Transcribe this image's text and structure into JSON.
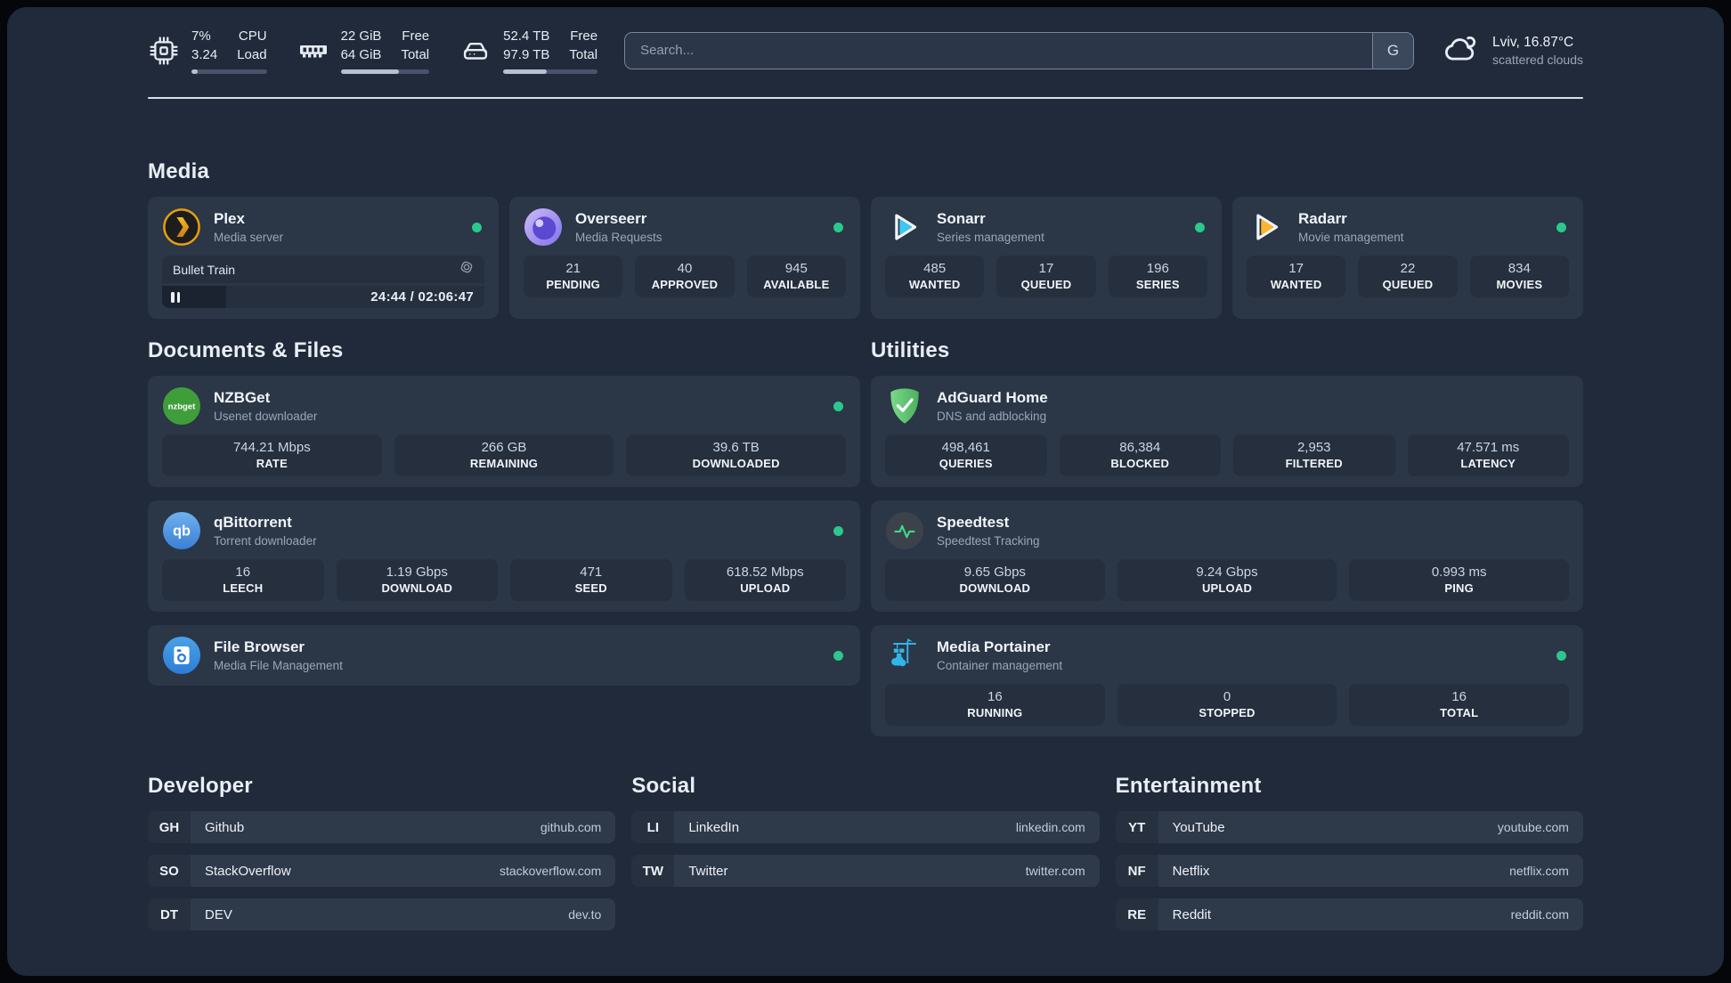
{
  "system_stats": {
    "cpu": {
      "value_line1": "7%",
      "value_line2": "3.24",
      "label_line1": "CPU",
      "label_line2": "Load",
      "progress_pct": 8
    },
    "memory": {
      "value_line1": "22 GiB",
      "value_line2": "64 GiB",
      "label_line1": "Free",
      "label_line2": "Total",
      "progress_pct": 66
    },
    "storage": {
      "value_line1": "52.4 TB",
      "value_line2": "97.9 TB",
      "label_line1": "Free",
      "label_line2": "Total",
      "progress_pct": 46
    }
  },
  "search": {
    "placeholder": "Search...",
    "provider_button": "G"
  },
  "weather": {
    "location": "Lviv, 16.87°C",
    "condition": "scattered clouds"
  },
  "sections": {
    "media": {
      "title": "Media",
      "apps": {
        "plex": {
          "name": "Plex",
          "description": "Media server",
          "status": "online",
          "player": {
            "title": "Bullet Train",
            "time_display": "24:44 / 02:06:47",
            "progress_pct": 20,
            "state": "paused"
          }
        },
        "overseerr": {
          "name": "Overseerr",
          "description": "Media Requests",
          "status": "online",
          "stats": [
            {
              "value": "21",
              "label": "PENDING"
            },
            {
              "value": "40",
              "label": "APPROVED"
            },
            {
              "value": "945",
              "label": "AVAILABLE"
            }
          ]
        },
        "sonarr": {
          "name": "Sonarr",
          "description": "Series management",
          "status": "online",
          "stats": [
            {
              "value": "485",
              "label": "WANTED"
            },
            {
              "value": "17",
              "label": "QUEUED"
            },
            {
              "value": "196",
              "label": "SERIES"
            }
          ]
        },
        "radarr": {
          "name": "Radarr",
          "description": "Movie management",
          "status": "online",
          "stats": [
            {
              "value": "17",
              "label": "WANTED"
            },
            {
              "value": "22",
              "label": "QUEUED"
            },
            {
              "value": "834",
              "label": "MOVIES"
            }
          ]
        }
      }
    },
    "documents": {
      "title": "Documents & Files",
      "apps": {
        "nzbget": {
          "name": "NZBGet",
          "description": "Usenet downloader",
          "status": "online",
          "stats": [
            {
              "value": "744.21 Mbps",
              "label": "RATE"
            },
            {
              "value": "266 GB",
              "label": "REMAINING"
            },
            {
              "value": "39.6 TB",
              "label": "DOWNLOADED"
            }
          ]
        },
        "qbittorrent": {
          "name": "qBittorrent",
          "description": "Torrent downloader",
          "status": "online",
          "stats": [
            {
              "value": "16",
              "label": "LEECH"
            },
            {
              "value": "1.19 Gbps",
              "label": "DOWNLOAD"
            },
            {
              "value": "471",
              "label": "SEED"
            },
            {
              "value": "618.52 Mbps",
              "label": "UPLOAD"
            }
          ]
        },
        "filebrowser": {
          "name": "File Browser",
          "description": "Media File Management",
          "status": "online"
        }
      }
    },
    "utilities": {
      "title": "Utilities",
      "apps": {
        "adguard": {
          "name": "AdGuard Home",
          "description": "DNS and adblocking",
          "stats": [
            {
              "value": "498,461",
              "label": "QUERIES"
            },
            {
              "value": "86,384",
              "label": "BLOCKED"
            },
            {
              "value": "2,953",
              "label": "FILTERED"
            },
            {
              "value": "47.571 ms",
              "label": "LATENCY"
            }
          ]
        },
        "speedtest": {
          "name": "Speedtest",
          "description": "Speedtest Tracking",
          "stats": [
            {
              "value": "9.65 Gbps",
              "label": "DOWNLOAD"
            },
            {
              "value": "9.24 Gbps",
              "label": "UPLOAD"
            },
            {
              "value": "0.993 ms",
              "label": "PING"
            }
          ]
        },
        "portainer": {
          "name": "Media Portainer",
          "description": "Container management",
          "status": "online",
          "stats": [
            {
              "value": "16",
              "label": "RUNNING"
            },
            {
              "value": "0",
              "label": "STOPPED"
            },
            {
              "value": "16",
              "label": "TOTAL"
            }
          ]
        }
      }
    },
    "developer": {
      "title": "Developer",
      "links": [
        {
          "tag": "GH",
          "name": "Github",
          "url": "github.com"
        },
        {
          "tag": "SO",
          "name": "StackOverflow",
          "url": "stackoverflow.com"
        },
        {
          "tag": "DT",
          "name": "DEV",
          "url": "dev.to"
        }
      ]
    },
    "social": {
      "title": "Social",
      "links": [
        {
          "tag": "LI",
          "name": "LinkedIn",
          "url": "linkedin.com"
        },
        {
          "tag": "TW",
          "name": "Twitter",
          "url": "twitter.com"
        }
      ]
    },
    "entertainment": {
      "title": "Entertainment",
      "links": [
        {
          "tag": "YT",
          "name": "YouTube",
          "url": "youtube.com"
        },
        {
          "tag": "NF",
          "name": "Netflix",
          "url": "netflix.com"
        },
        {
          "tag": "RE",
          "name": "Reddit",
          "url": "reddit.com"
        }
      ]
    }
  },
  "colors": {
    "status_online": "#2ac98b",
    "plex_accent": "#e5a00d",
    "divider": "#d9e0ea"
  }
}
